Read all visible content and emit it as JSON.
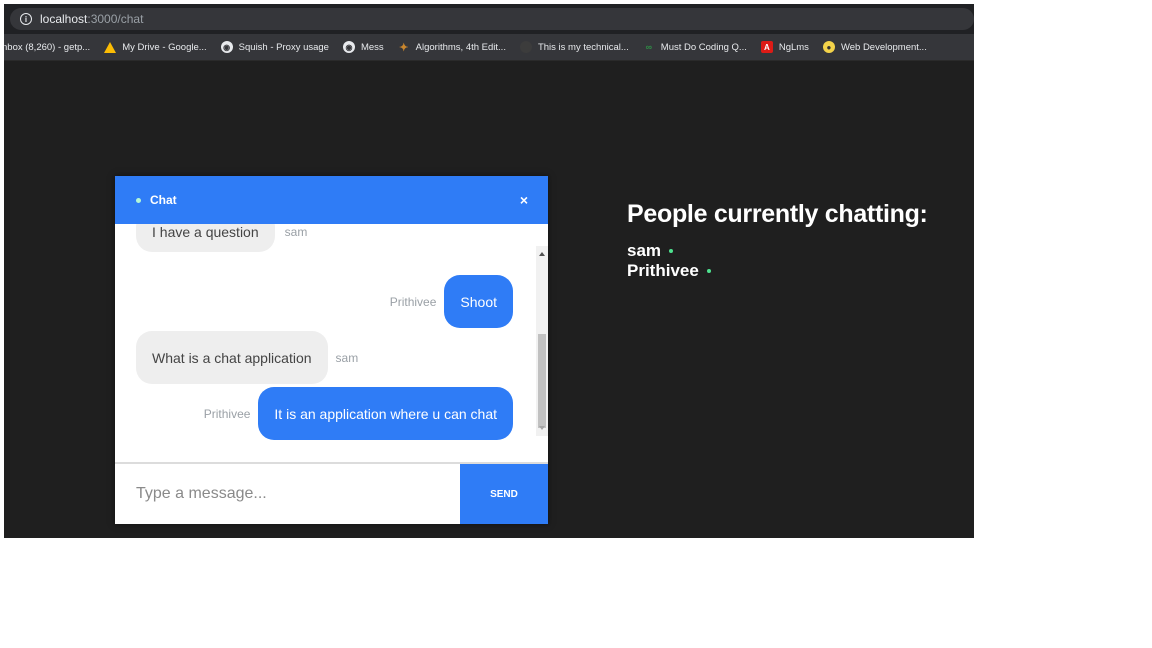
{
  "browser": {
    "url_host": "localhost",
    "url_path": ":3000/chat",
    "bookmarks": [
      {
        "label": "nbox (8,260) - getp...",
        "icon": "gmail-icon",
        "color": "#35363a"
      },
      {
        "label": "My Drive - Google...",
        "icon": "google-drive-icon",
        "color": "#fbbc04"
      },
      {
        "label": "Squish - Proxy usage",
        "icon": "globe-icon",
        "color": "#ffffff"
      },
      {
        "label": "Mess",
        "icon": "globe-icon",
        "color": "#ffffff"
      },
      {
        "label": "Algorithms, 4th Edit...",
        "icon": "algorithms-icon",
        "color": "#c9862d"
      },
      {
        "label": "This is my technical...",
        "icon": "github-icon",
        "color": "#3c3c3c"
      },
      {
        "label": "Must Do Coding Q...",
        "icon": "geeksforgeeks-icon",
        "color": "#2f8d46"
      },
      {
        "label": "NgLms",
        "icon": "angular-icon",
        "color": "#dd1b16"
      },
      {
        "label": "Web Development...",
        "icon": "web-dev-icon",
        "color": "#f3d34a"
      }
    ]
  },
  "chat": {
    "title": "Chat",
    "close_label": "×",
    "messages": [
      {
        "text": "I have a question",
        "sender": "sam",
        "direction": "in"
      },
      {
        "text": "Shoot",
        "sender": "Prithivee",
        "direction": "out"
      },
      {
        "text": "What is a chat application",
        "sender": "sam",
        "direction": "in"
      },
      {
        "text": "It is an application where u can chat",
        "sender": "Prithivee",
        "direction": "out"
      }
    ],
    "input_placeholder": "Type a message...",
    "send_label": "SEND",
    "accent_color": "#2f7cf6"
  },
  "people": {
    "title": "People currently chatting:",
    "list": [
      "sam",
      "Prithivee"
    ],
    "status_color": "#4ee28f"
  }
}
